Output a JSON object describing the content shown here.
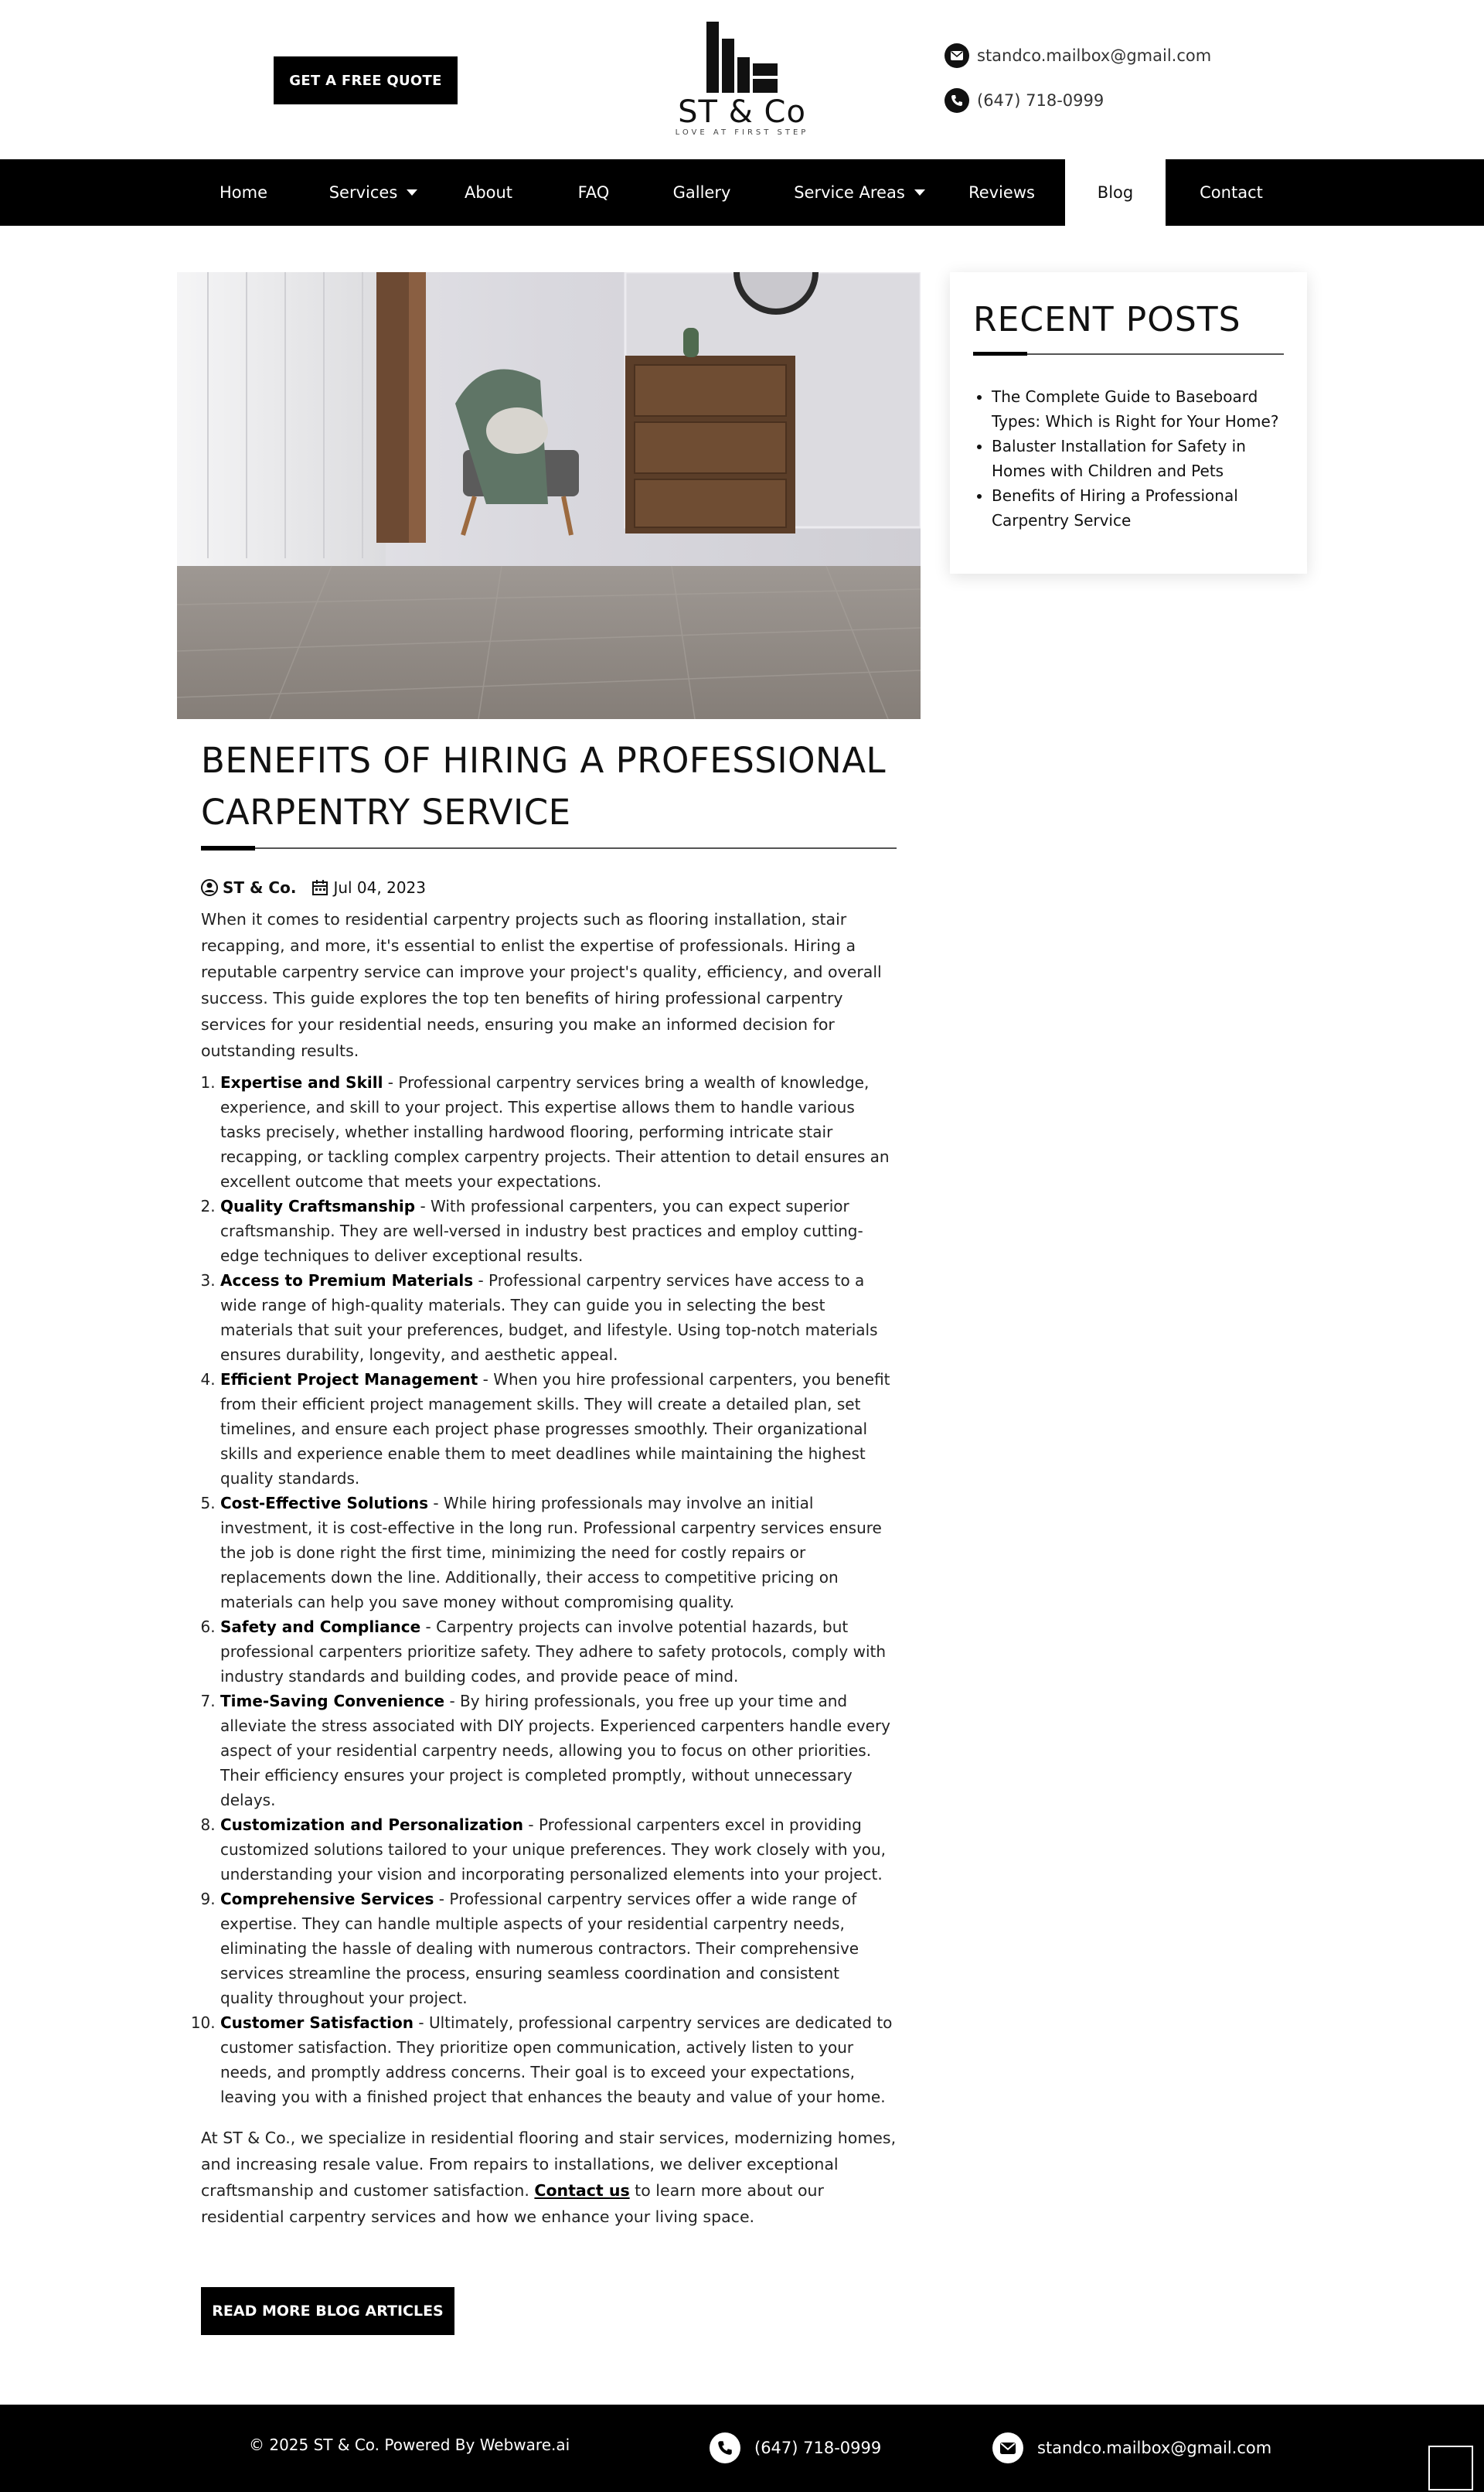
{
  "header": {
    "quote_button": "GET A FREE QUOTE",
    "logo_text": "ST & Co",
    "logo_tagline": "LOVE AT FIRST STEP",
    "email": "standco.mailbox@gmail.com",
    "phone": "(647) 718-0999"
  },
  "nav": {
    "items": [
      {
        "label": "Home"
      },
      {
        "label": "Services"
      },
      {
        "label": "About"
      },
      {
        "label": "FAQ"
      },
      {
        "label": "Gallery"
      },
      {
        "label": "Service Areas"
      },
      {
        "label": "Reviews"
      },
      {
        "label": "Blog"
      },
      {
        "label": "Contact"
      }
    ],
    "active": "Blog"
  },
  "article": {
    "title": "BENEFITS OF HIRING A PROFESSIONAL CARPENTRY SERVICE",
    "author": "ST & Co.",
    "date": "Jul 04, 2023",
    "intro": "When it comes to residential carpentry projects such as flooring installation, stair recapping, and more, it's essential to enlist the expertise of professionals. Hiring a reputable carpentry service can improve your project's quality, efficiency, and overall success. This guide explores the top ten benefits of hiring professional carpentry services for your residential needs, ensuring you make an informed decision for outstanding results.",
    "benefits": [
      {
        "title": "Expertise and Skill",
        "text": " - Professional carpentry services bring a wealth of knowledge, experience, and skill to your project. This expertise allows them to handle various tasks precisely, whether installing hardwood flooring, performing intricate stair recapping, or tackling complex carpentry projects. Their attention to detail ensures an excellent outcome that meets your expectations."
      },
      {
        "title": "Quality Craftsmanship",
        "text": " - With professional carpenters, you can expect superior craftsmanship. They are well-versed in industry best practices and employ cutting-edge techniques to deliver exceptional results."
      },
      {
        "title": "Access to Premium Materials",
        "text": " - Professional carpentry services have access to a wide range of high-quality materials. They can guide you in selecting the best materials that suit your preferences, budget, and lifestyle. Using top-notch materials ensures durability, longevity, and aesthetic appeal."
      },
      {
        "title": "Efficient Project Management",
        "text": " - When you hire professional carpenters, you benefit from their efficient project management skills. They will create a detailed plan, set timelines, and ensure each project phase progresses smoothly. Their organizational skills and experience enable them to meet deadlines while maintaining the highest quality standards."
      },
      {
        "title": "Cost-Effective Solutions",
        "text": " - While hiring professionals may involve an initial investment, it is cost-effective in the long run. Professional carpentry services ensure the job is done right the first time, minimizing the need for costly repairs or replacements down the line. Additionally, their access to competitive pricing on materials can help you save money without compromising quality."
      },
      {
        "title": "Safety and Compliance",
        "text": " - Carpentry projects can involve potential hazards, but professional carpenters prioritize safety. They adhere to safety protocols, comply with industry standards and building codes, and provide peace of mind."
      },
      {
        "title": "Time-Saving Convenience",
        "text": " - By hiring professionals, you free up your time and alleviate the stress associated with DIY projects. Experienced carpenters handle every aspect of your residential carpentry needs, allowing you to focus on other priorities. Their efficiency ensures your project is completed promptly, without unnecessary delays."
      },
      {
        "title": "Customization and Personalization",
        "text": " - Professional carpenters excel in providing customized solutions tailored to your unique preferences. They work closely with you, understanding your vision and incorporating personalized elements into your project."
      },
      {
        "title": "Comprehensive Services",
        "text": " - Professional carpentry services offer a wide range of expertise. They can handle multiple aspects of your residential carpentry needs, eliminating the hassle of dealing with numerous contractors. Their comprehensive services streamline the process, ensuring seamless coordination and consistent quality throughout your project."
      },
      {
        "title": "Customer Satisfaction",
        "text": " - Ultimately, professional carpentry services are dedicated to customer satisfaction. They prioritize open communication, actively listen to your needs, and promptly address concerns. Their goal is to exceed your expectations, leaving you with a finished project that enhances the beauty and value of your home."
      }
    ],
    "closing_before": "At ST & Co., we specialize in residential flooring and stair services, modernizing homes, and increasing resale value. From repairs to installations, we deliver exceptional craftsmanship and customer satisfaction. ",
    "closing_link": "Contact us",
    "closing_after": " to learn more about our residential carpentry services and how we enhance your living space.",
    "read_more": "READ MORE BLOG ARTICLES"
  },
  "sidebar": {
    "title": "RECENT POSTS",
    "posts": [
      "The Complete Guide to Baseboard Types: Which is Right for Your Home?",
      "Baluster Installation for Safety in Homes with Children and Pets",
      "Benefits of Hiring a Professional Carpentry Service"
    ]
  },
  "footer": {
    "copyright": "© 2025 ST & Co. Powered By Webware.ai",
    "phone": "(647) 718-0999",
    "email": "standco.mailbox@gmail.com"
  },
  "colors": {
    "nav_bg": "#000000",
    "accent": "#000000",
    "active_tab_bg": "#ffffff"
  }
}
